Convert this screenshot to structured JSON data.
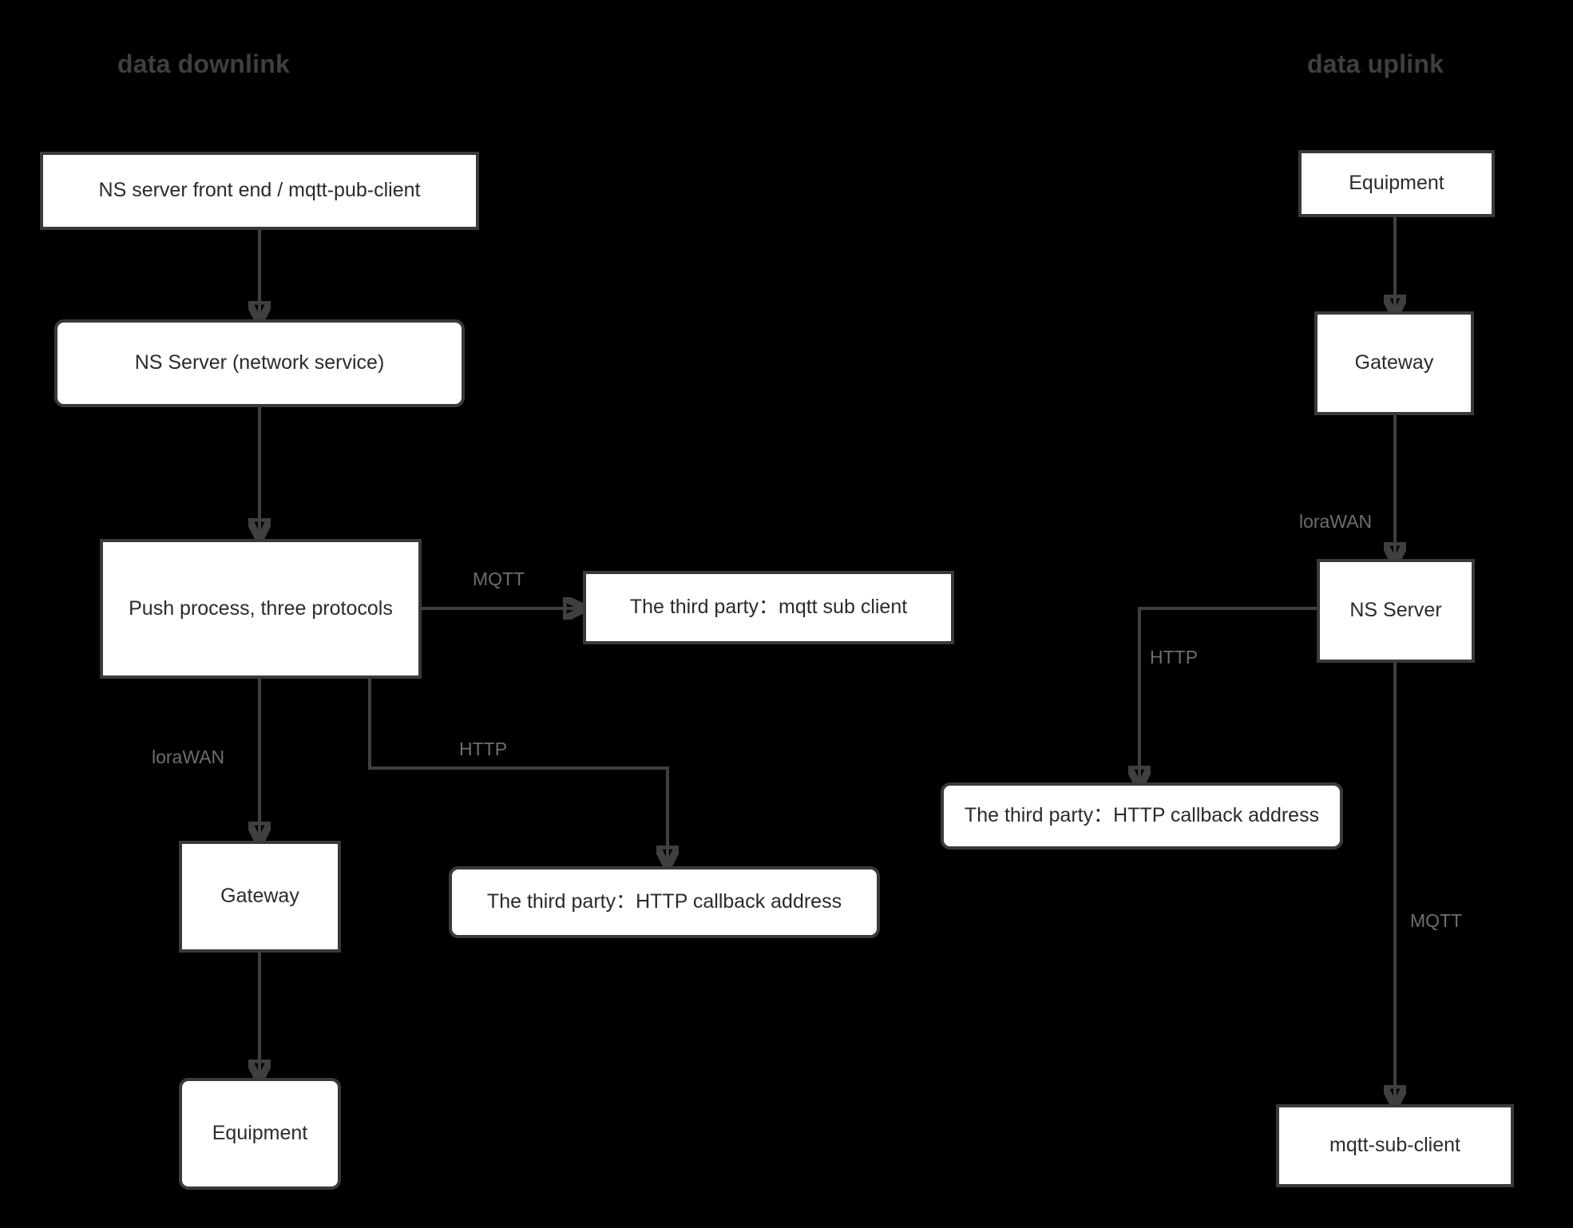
{
  "diagram": {
    "background_color": "#000000",
    "node_fill": "#ffffff",
    "node_border_color": "#3a3a3a",
    "edge_color": "#3f3f3f",
    "label_color": "#6e6e6e",
    "title_color": "#3f3f3f"
  },
  "titles": {
    "downlink": "data downlink",
    "uplink": "data uplink"
  },
  "downlink": {
    "front_end": "NS server front end / mqtt-pub-client",
    "ns_server": "NS Server (network service)",
    "push_process": "Push process, three protocols",
    "third_party_mqtt": "The third party：mqtt sub client",
    "third_party_http": "The third party：HTTP callback address",
    "gateway": "Gateway",
    "equipment": "Equipment",
    "label_mqtt": "MQTT",
    "label_http": "HTTP",
    "label_lorawan": "loraWAN"
  },
  "uplink": {
    "equipment": "Equipment",
    "gateway": "Gateway",
    "ns_server": "NS Server",
    "third_party_http": "The third party：HTTP callback address",
    "mqtt_sub_client": "mqtt-sub-client",
    "label_lorawan": "loraWAN",
    "label_http": "HTTP",
    "label_mqtt": "MQTT"
  }
}
